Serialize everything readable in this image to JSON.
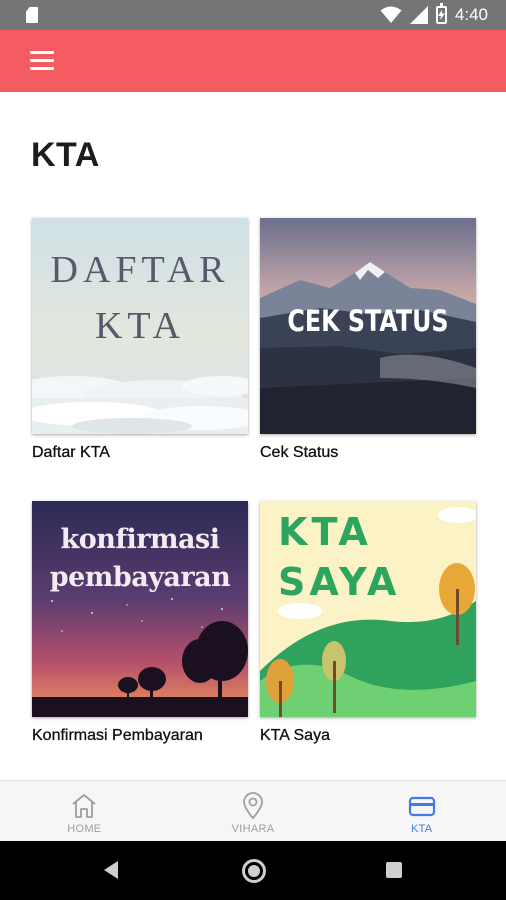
{
  "status_bar": {
    "time": "4:40",
    "icons": [
      "sd-card-icon",
      "wifi-icon",
      "signal-icon",
      "battery-charging-icon"
    ]
  },
  "app_bar": {
    "menu_icon": "hamburger-menu-icon",
    "color": "#f45c62"
  },
  "page": {
    "title": "KTA"
  },
  "cards": [
    {
      "label": "Daftar KTA",
      "image_text": [
        "DAFTAR",
        "KTA"
      ]
    },
    {
      "label": "Cek Status",
      "image_text": [
        "CEK STATUS"
      ]
    },
    {
      "label": "Konfirmasi Pembayaran",
      "image_text": [
        "konfirmasi",
        "pembayaran"
      ]
    },
    {
      "label": "KTA Saya",
      "image_text": [
        "KTA",
        "SAYA"
      ]
    }
  ],
  "bottom_nav": {
    "items": [
      {
        "label": "HOME",
        "icon": "home-icon",
        "active": false
      },
      {
        "label": "VIHARA",
        "icon": "location-pin-icon",
        "active": false
      },
      {
        "label": "KTA",
        "icon": "card-icon",
        "active": true
      }
    ],
    "active_color": "#3f7ee0",
    "inactive_color": "#9e9e9e"
  },
  "system_nav": {
    "buttons": [
      "back-icon",
      "home-circle-icon",
      "recents-icon"
    ]
  }
}
